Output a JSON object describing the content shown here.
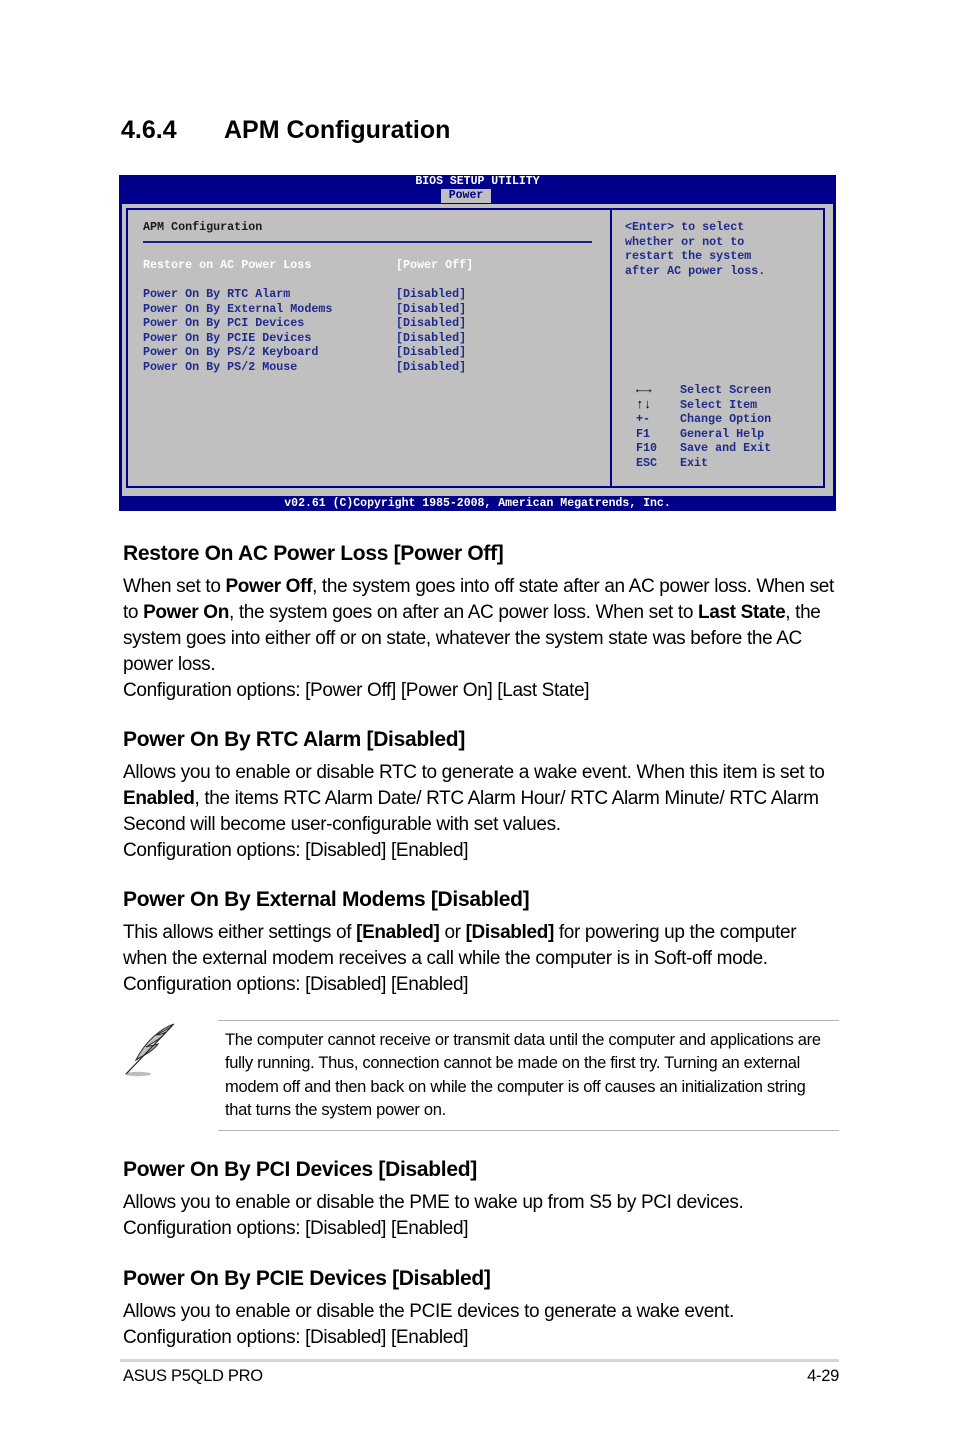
{
  "section": {
    "number": "4.6.4",
    "title": "APM Configuration"
  },
  "bios": {
    "title": "BIOS SETUP UTILITY",
    "active_tab": "Power",
    "panel_title": "APM Configuration",
    "selected_item": {
      "label": "Restore on AC Power Loss",
      "value": "[Power Off]"
    },
    "items": [
      {
        "label": "Power On By RTC Alarm",
        "value": "[Disabled]"
      },
      {
        "label": "Power On By External Modems",
        "value": "[Disabled]"
      },
      {
        "label": "Power On By PCI Devices",
        "value": "[Disabled]"
      },
      {
        "label": "Power On By PCIE Devices",
        "value": "[Disabled]"
      },
      {
        "label": "Power On By PS/2 Keyboard",
        "value": "[Disabled]"
      },
      {
        "label": "Power On By PS/2 Mouse",
        "value": "[Disabled]"
      }
    ],
    "help_text": "<Enter> to select\nwhether or not to\nrestart the system\nafter AC power loss.",
    "keys": [
      {
        "key": "←→",
        "icon": "left-right-arrows-icon",
        "action": "Select Screen"
      },
      {
        "key": "↑↓",
        "icon": "up-down-arrows-icon",
        "action": "Select Item"
      },
      {
        "key": "+-",
        "action": "Change Option"
      },
      {
        "key": "F1",
        "action": "General Help"
      },
      {
        "key": "F10",
        "action": "Save and Exit"
      },
      {
        "key": "ESC",
        "action": "Exit"
      }
    ],
    "footer": "v02.61 (C)Copyright 1985-2008, American Megatrends, Inc.",
    "colors": {
      "background": "#00008a",
      "panel": "#c0c0c0",
      "text": "#1e2a8c",
      "selected": "#ffffff"
    }
  },
  "entries": {
    "restore": {
      "heading": "Restore On AC Power Loss [Power Off]",
      "t1": "When set to ",
      "b1": "Power Off",
      "t2": ", the system goes into off state after an AC power loss. When set to ",
      "b2": "Power On",
      "t3": ", the system goes on after an AC power loss. When set to ",
      "b3": "Last State",
      "t4": ", the system goes into either off or on state, whatever the system state was before the AC power loss.",
      "options": "Configuration options: [Power Off] [Power On] [Last State]"
    },
    "rtc": {
      "heading": "Power On By RTC Alarm [Disabled]",
      "t1": "Allows you to enable or disable RTC to generate a wake event. When this item is set to ",
      "b1": "Enabled",
      "t2": ", the items RTC Alarm Date/ RTC Alarm Hour/ RTC Alarm Minute/ RTC Alarm Second will become user-configurable with set values.",
      "options": "Configuration options: [Disabled] [Enabled]"
    },
    "modems": {
      "heading": "Power On By External Modems [Disabled]",
      "t1": "This allows either settings of ",
      "b1": "[Enabled]",
      "t2": " or ",
      "b2": "[Disabled]",
      "t3": " for powering up the computer when the external modem receives a call while the computer is in Soft-off mode. Configuration options: [Disabled] [Enabled]"
    },
    "note": "The computer cannot receive or transmit data until the computer and applications are fully running. Thus, connection cannot be made on the first try. Turning an external modem off and then back on while the computer is off causes an initialization string that turns the system power on.",
    "pci": {
      "heading": "Power On By PCI Devices [Disabled]",
      "text": "Allows you to enable or disable the PME to wake up from S5 by PCI devices.",
      "options": "Configuration options: [Disabled] [Enabled]"
    },
    "pcie": {
      "heading": "Power On By PCIE Devices [Disabled]",
      "text": "Allows you to enable or disable the PCIE devices to generate a wake event.",
      "options": "Configuration options: [Disabled] [Enabled]"
    }
  },
  "footer": {
    "product": "ASUS P5QLD PRO",
    "page": "4-29"
  }
}
